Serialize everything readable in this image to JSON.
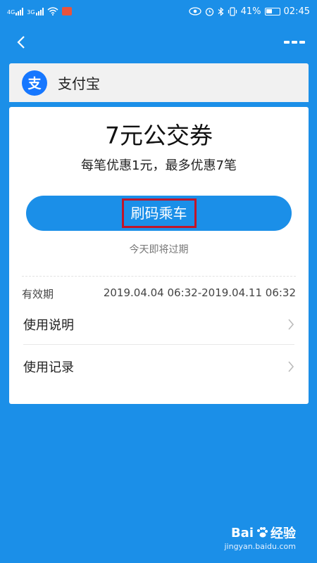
{
  "status_bar": {
    "net1": "4G",
    "net2": "3G",
    "battery": "41%",
    "time": "02:45"
  },
  "nav": {
    "back_icon": "chevron-left-icon",
    "more_icon": "more-dots-icon"
  },
  "header": {
    "logo_char": "支",
    "app_name": "支付宝"
  },
  "coupon": {
    "title": "7元公交券",
    "description": "每笔优惠1元，最多优惠7笔",
    "ride_button_label": "刷码乘车",
    "expire_note": "今天即将过期",
    "validity_label": "有效期",
    "validity_value": "2019.04.04 06:32-2019.04.11 06:32"
  },
  "list": [
    {
      "label": "使用说明"
    },
    {
      "label": "使用记录"
    }
  ],
  "watermark": {
    "brand": "Bai",
    "brand_suffix": "经验",
    "url": "jingyan.baidu.com"
  },
  "colors": {
    "primary": "#1b8fe8",
    "highlight_border": "#c0152a",
    "logo_blue": "#1677ff"
  }
}
